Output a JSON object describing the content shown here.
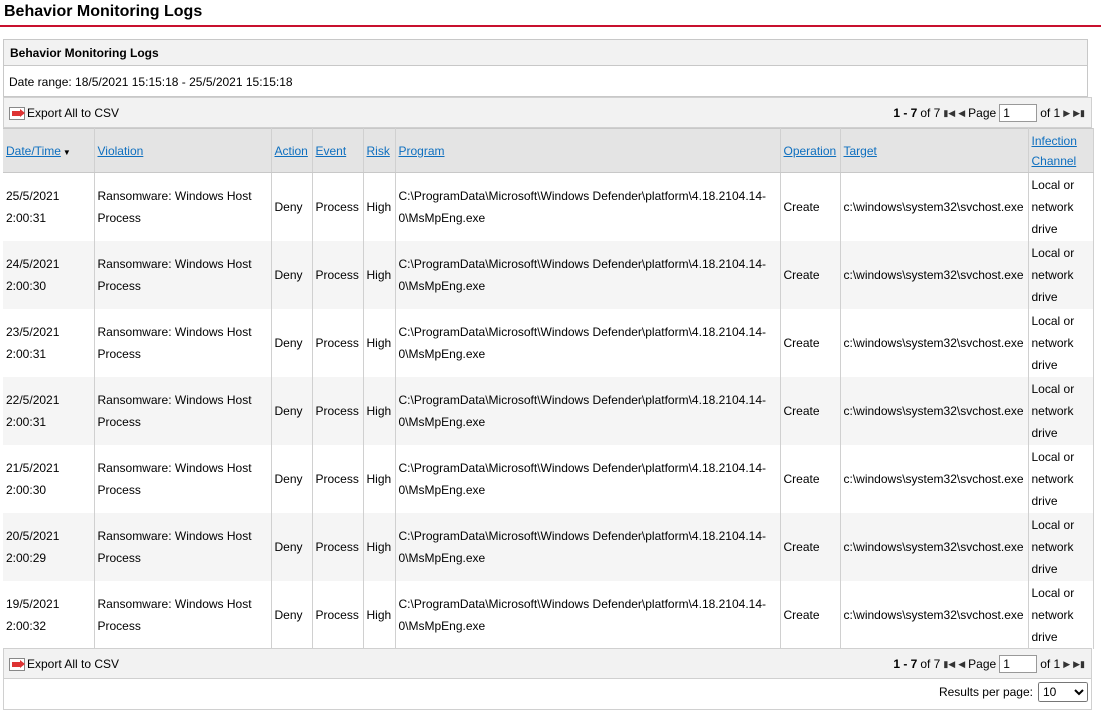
{
  "page_title": "Behavior Monitoring Logs",
  "panel_title": "Behavior Monitoring Logs",
  "date_range": "Date range: 18/5/2021 15:15:18 - 25/5/2021 15:15:18",
  "export_label": "Export All to CSV",
  "pager": {
    "range": "1 - 7",
    "of_total": "of 7",
    "page_label": "Page",
    "page_value": "1",
    "of_pages": "of 1",
    "first_icon": "first-page-icon",
    "prev_icon": "previous-page-icon",
    "next_icon": "next-page-icon",
    "last_icon": "last-page-icon"
  },
  "results_per_page": {
    "label": "Results per page:",
    "value": "10"
  },
  "columns": {
    "datetime": "Date/Time",
    "violation": "Violation",
    "action": "Action",
    "event": "Event",
    "risk": "Risk",
    "program": "Program",
    "operation": "Operation",
    "target": "Target",
    "channel": "Infection Channel"
  },
  "rows": [
    {
      "date": "25/5/2021",
      "time": "2:00:31",
      "violation": "Ransomware: Windows Host Process",
      "action": "Deny",
      "event": "Process",
      "risk": "High",
      "program": "C:\\ProgramData\\Microsoft\\Windows Defender\\platform\\4.18.2104.14-0\\MsMpEng.exe",
      "operation": "Create",
      "target": "c:\\windows\\system32\\svchost.exe",
      "channel": "Local or network drive"
    },
    {
      "date": "24/5/2021",
      "time": "2:00:30",
      "violation": "Ransomware: Windows Host Process",
      "action": "Deny",
      "event": "Process",
      "risk": "High",
      "program": "C:\\ProgramData\\Microsoft\\Windows Defender\\platform\\4.18.2104.14-0\\MsMpEng.exe",
      "operation": "Create",
      "target": "c:\\windows\\system32\\svchost.exe",
      "channel": "Local or network drive"
    },
    {
      "date": "23/5/2021",
      "time": "2:00:31",
      "violation": "Ransomware: Windows Host Process",
      "action": "Deny",
      "event": "Process",
      "risk": "High",
      "program": "C:\\ProgramData\\Microsoft\\Windows Defender\\platform\\4.18.2104.14-0\\MsMpEng.exe",
      "operation": "Create",
      "target": "c:\\windows\\system32\\svchost.exe",
      "channel": "Local or network drive"
    },
    {
      "date": "22/5/2021",
      "time": "2:00:31",
      "violation": "Ransomware: Windows Host Process",
      "action": "Deny",
      "event": "Process",
      "risk": "High",
      "program": "C:\\ProgramData\\Microsoft\\Windows Defender\\platform\\4.18.2104.14-0\\MsMpEng.exe",
      "operation": "Create",
      "target": "c:\\windows\\system32\\svchost.exe",
      "channel": "Local or network drive"
    },
    {
      "date": "21/5/2021",
      "time": "2:00:30",
      "violation": "Ransomware: Windows Host Process",
      "action": "Deny",
      "event": "Process",
      "risk": "High",
      "program": "C:\\ProgramData\\Microsoft\\Windows Defender\\platform\\4.18.2104.14-0\\MsMpEng.exe",
      "operation": "Create",
      "target": "c:\\windows\\system32\\svchost.exe",
      "channel": "Local or network drive"
    },
    {
      "date": "20/5/2021",
      "time": "2:00:29",
      "violation": "Ransomware: Windows Host Process",
      "action": "Deny",
      "event": "Process",
      "risk": "High",
      "program": "C:\\ProgramData\\Microsoft\\Windows Defender\\platform\\4.18.2104.14-0\\MsMpEng.exe",
      "operation": "Create",
      "target": "c:\\windows\\system32\\svchost.exe",
      "channel": "Local or network drive"
    },
    {
      "date": "19/5/2021",
      "time": "2:00:32",
      "violation": "Ransomware: Windows Host Process",
      "action": "Deny",
      "event": "Process",
      "risk": "High",
      "program": "C:\\ProgramData\\Microsoft\\Windows Defender\\platform\\4.18.2104.14-0\\MsMpEng.exe",
      "operation": "Create",
      "target": "c:\\windows\\system32\\svchost.exe",
      "channel": "Local or network drive"
    }
  ]
}
